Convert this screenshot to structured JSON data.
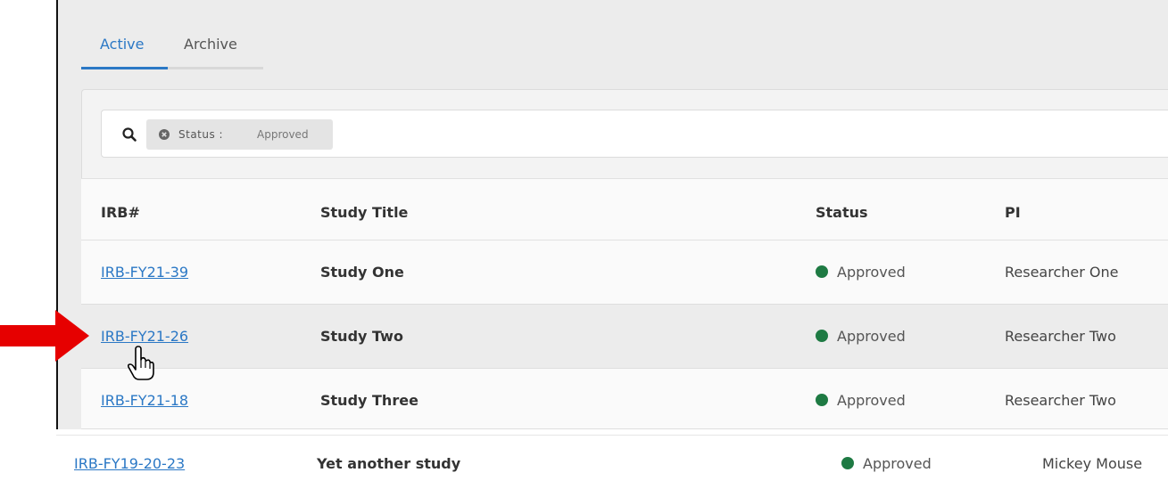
{
  "tabs": {
    "active_label": "Active",
    "archive_label": "Archive"
  },
  "search": {
    "filter_label": "Status :",
    "filter_value": "Approved"
  },
  "table": {
    "headers": {
      "irb": "IRB#",
      "title": "Study Title",
      "status": "Status",
      "pi": "PI"
    },
    "rows": [
      {
        "irb": "IRB-FY21-39",
        "title": "Study One",
        "status": "Approved",
        "pi": "Researcher One"
      },
      {
        "irb": "IRB-FY21-26",
        "title": "Study Two",
        "status": "Approved",
        "pi": "Researcher Two"
      },
      {
        "irb": "IRB-FY21-18",
        "title": "Study Three",
        "status": "Approved",
        "pi": "Researcher Two"
      }
    ]
  },
  "bottom_row": {
    "irb": "IRB-FY19-20-23",
    "title": "Yet another study",
    "status": "Approved",
    "pi": "Mickey Mouse"
  },
  "colors": {
    "accent": "#2b78c5",
    "status_approved": "#1e7a43",
    "arrow": "#e60000"
  }
}
